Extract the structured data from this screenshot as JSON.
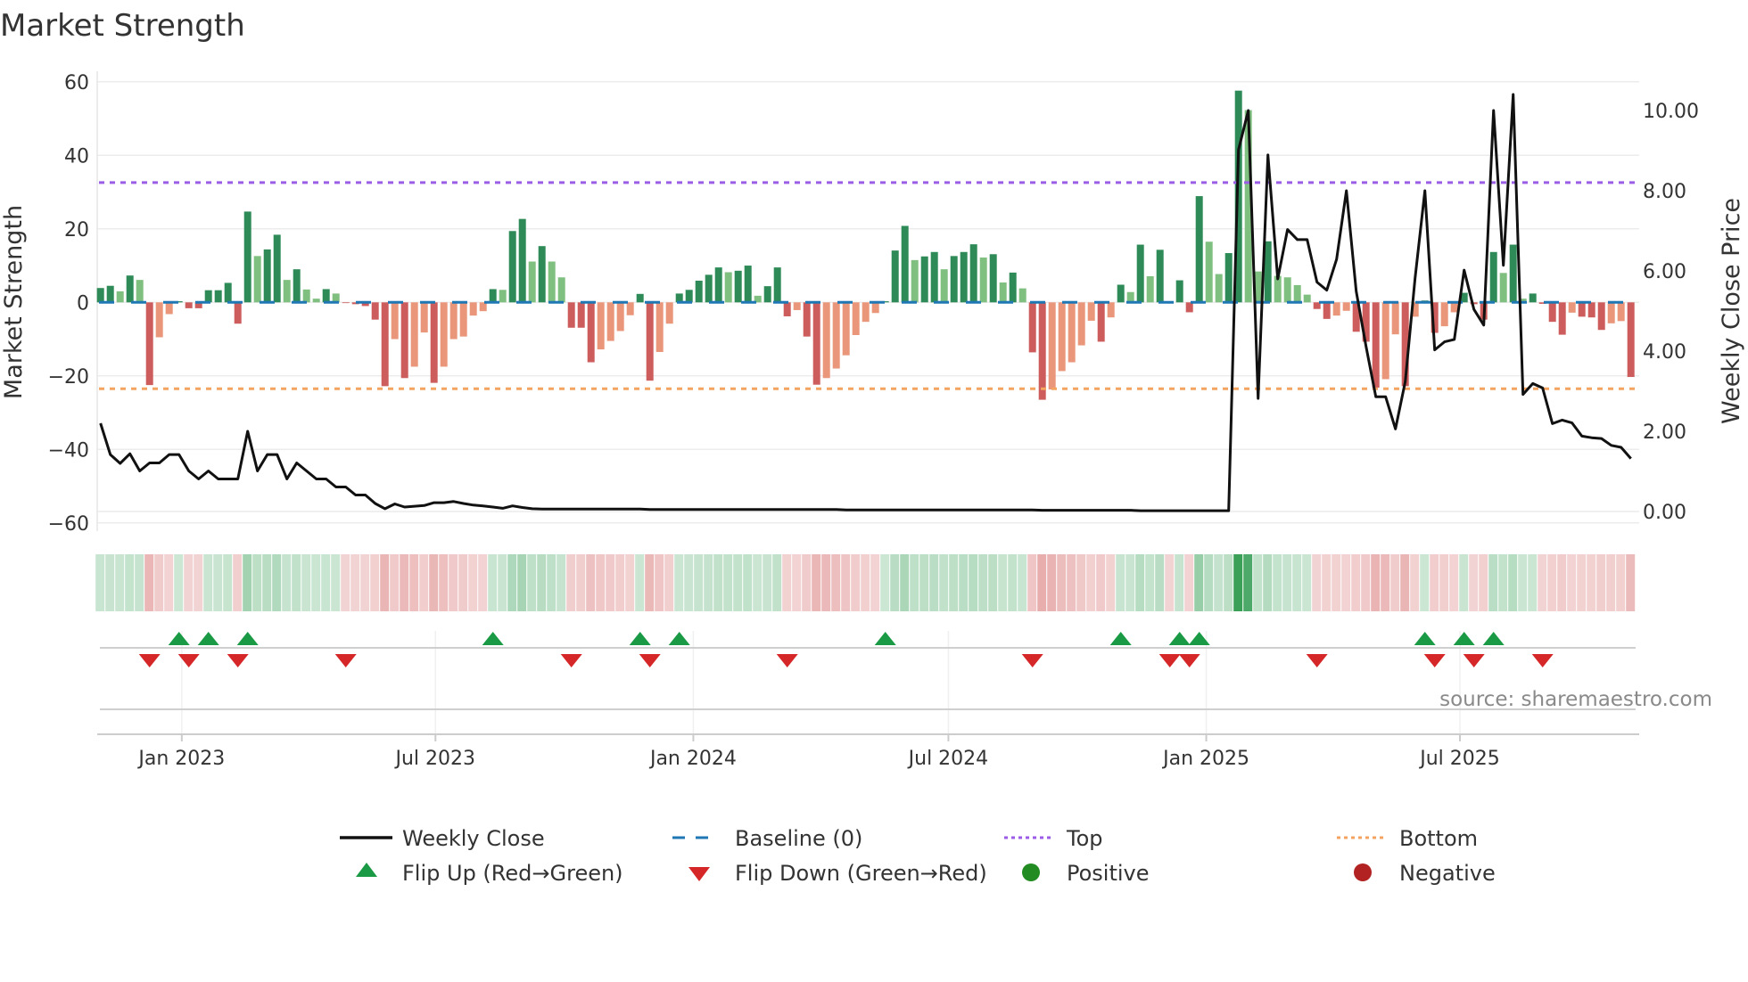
{
  "title": "Market Strength",
  "source": "source: sharemaestro.com",
  "legend": {
    "weekly_close": "Weekly Close",
    "baseline": "Baseline (0)",
    "top": "Top",
    "bottom": "Bottom",
    "flip_up": "Flip Up (Red→Green)",
    "flip_down": "Flip Down (Green→Red)",
    "positive": "Positive",
    "negative": "Negative"
  },
  "colors": {
    "strong_green": "#2e8b57",
    "weak_green": "#7fbf7f",
    "strong_red": "#cd5c5c",
    "weak_red": "#e9967a",
    "baseline": "#1f77b4",
    "top": "#9b5de5",
    "bottom": "#f4a460",
    "line": "#111111",
    "flip_up": "#1a9a45",
    "flip_down": "#d62728",
    "positive": "#228b22",
    "negative": "#b22222"
  },
  "chart_data": {
    "type": "bar",
    "title": "Market Strength",
    "ylabel": "Market Strength",
    "y2label": "Weekly Close Price",
    "ylim": [
      -60,
      60
    ],
    "y2lim": [
      -0.33,
      10.76
    ],
    "yticks": [
      "60",
      "40",
      "20",
      "0",
      "−20",
      "−40",
      "−60"
    ],
    "ytick_values": [
      60,
      40,
      20,
      0,
      -20,
      -40,
      -60
    ],
    "y2ticks": [
      "0.00",
      "2.00",
      "4.00",
      "6.00",
      "8.00",
      "10.00"
    ],
    "y2tick_values": [
      0,
      2,
      4,
      6,
      8,
      10
    ],
    "x_start": "2022-11-04",
    "x_step_days": 7,
    "xticks": [
      {
        "label": "Jan 2023",
        "date": "2023-01-01"
      },
      {
        "label": "Jul 2023",
        "date": "2023-07-01"
      },
      {
        "label": "Jan 2024",
        "date": "2024-01-01"
      },
      {
        "label": "Jul 2024",
        "date": "2024-07-01"
      },
      {
        "label": "Jan 2025",
        "date": "2025-01-01"
      },
      {
        "label": "Jul 2025",
        "date": "2025-07-01"
      }
    ],
    "top_threshold": 32.6,
    "bottom_threshold": -23.5,
    "baseline": 0,
    "strength": [
      3.9,
      4.5,
      3.0,
      7.3,
      6.1,
      -22.5,
      -9.5,
      -3.2,
      0.3,
      -1.6,
      -1.6,
      3.3,
      3.3,
      5.3,
      -5.8,
      24.7,
      12.6,
      14.4,
      18.4,
      6.1,
      9.0,
      3.5,
      1.0,
      3.6,
      2.4,
      -0.2,
      -0.5,
      -1.0,
      -4.7,
      -22.8,
      -10.0,
      -20.6,
      -17.5,
      -8.2,
      -21.9,
      -17.5,
      -10.0,
      -9.3,
      -3.6,
      -2.4,
      3.6,
      3.4,
      19.4,
      22.7,
      11.1,
      15.3,
      11.1,
      6.8,
      -6.9,
      -6.9,
      -16.3,
      -12.8,
      -10.5,
      -7.8,
      -3.5,
      2.3,
      -21.3,
      -13.5,
      -5.8,
      2.4,
      3.4,
      5.9,
      7.5,
      9.5,
      8.2,
      8.6,
      10.0,
      1.8,
      4.4,
      9.5,
      -3.8,
      -2.1,
      -9.3,
      -22.4,
      -20.6,
      -18.0,
      -14.4,
      -8.9,
      -5.3,
      -2.9,
      0.3,
      14.1,
      20.8,
      11.5,
      12.5,
      13.7,
      9.0,
      12.6,
      13.7,
      15.8,
      12.2,
      13.1,
      5.4,
      8.1,
      3.8,
      -13.6,
      -26.5,
      -23.7,
      -18.7,
      -16.3,
      -11.7,
      -5.0,
      -10.7,
      -4.1,
      4.8,
      2.8,
      15.7,
      7.1,
      14.3,
      -0.3,
      6.0,
      -2.7,
      28.9,
      16.5,
      7.7,
      13.4,
      57.6,
      52.3,
      8.4,
      16.6,
      7.2,
      6.8,
      4.7,
      2.1,
      -1.8,
      -4.5,
      -3.6,
      -2.3,
      -8.0,
      -10.7,
      -23.2,
      -20.9,
      -8.7,
      -22.8,
      -3.9,
      0.5,
      -8.3,
      -6.5,
      -2.7,
      2.6,
      -0.5,
      -4.7,
      13.7,
      8.0,
      15.7,
      1.0,
      2.4,
      -0.4,
      -5.3,
      -8.8,
      -2.8,
      -3.9,
      -4.1,
      -7.5,
      -5.7,
      -5.1,
      -20.3
    ],
    "weekly_close": [
      2.2,
      1.42,
      1.2,
      1.44,
      1.01,
      1.21,
      1.21,
      1.42,
      1.42,
      1.01,
      0.81,
      1.01,
      0.81,
      0.81,
      0.81,
      2.0,
      1.01,
      1.42,
      1.42,
      0.81,
      1.21,
      1.01,
      0.81,
      0.81,
      0.61,
      0.61,
      0.41,
      0.41,
      0.2,
      0.07,
      0.19,
      0.11,
      0.13,
      0.15,
      0.22,
      0.22,
      0.25,
      0.2,
      0.16,
      0.14,
      0.11,
      0.08,
      0.14,
      0.1,
      0.07,
      0.06,
      0.06,
      0.06,
      0.06,
      0.06,
      0.06,
      0.06,
      0.06,
      0.06,
      0.06,
      0.06,
      0.05,
      0.05,
      0.05,
      0.05,
      0.05,
      0.05,
      0.05,
      0.05,
      0.05,
      0.05,
      0.05,
      0.05,
      0.05,
      0.05,
      0.05,
      0.05,
      0.05,
      0.05,
      0.05,
      0.05,
      0.04,
      0.04,
      0.04,
      0.04,
      0.04,
      0.04,
      0.04,
      0.04,
      0.04,
      0.04,
      0.04,
      0.04,
      0.04,
      0.04,
      0.04,
      0.04,
      0.04,
      0.04,
      0.04,
      0.04,
      0.03,
      0.03,
      0.03,
      0.03,
      0.03,
      0.03,
      0.03,
      0.03,
      0.03,
      0.03,
      0.02,
      0.02,
      0.02,
      0.02,
      0.02,
      0.02,
      0.02,
      0.02,
      0.02,
      0.02,
      9.02,
      10.0,
      2.82,
      8.89,
      5.8,
      7.03,
      6.78,
      6.78,
      5.72,
      5.52,
      6.29,
      8.0,
      5.49,
      4.12,
      2.86,
      2.86,
      2.06,
      3.24,
      5.82,
      8.0,
      4.03,
      4.23,
      4.29,
      6.02,
      5.04,
      4.65,
      10.0,
      6.14,
      10.4,
      2.92,
      3.19,
      3.08,
      2.19,
      2.28,
      2.21,
      1.88,
      1.84,
      1.82,
      1.65,
      1.6,
      1.32
    ]
  }
}
